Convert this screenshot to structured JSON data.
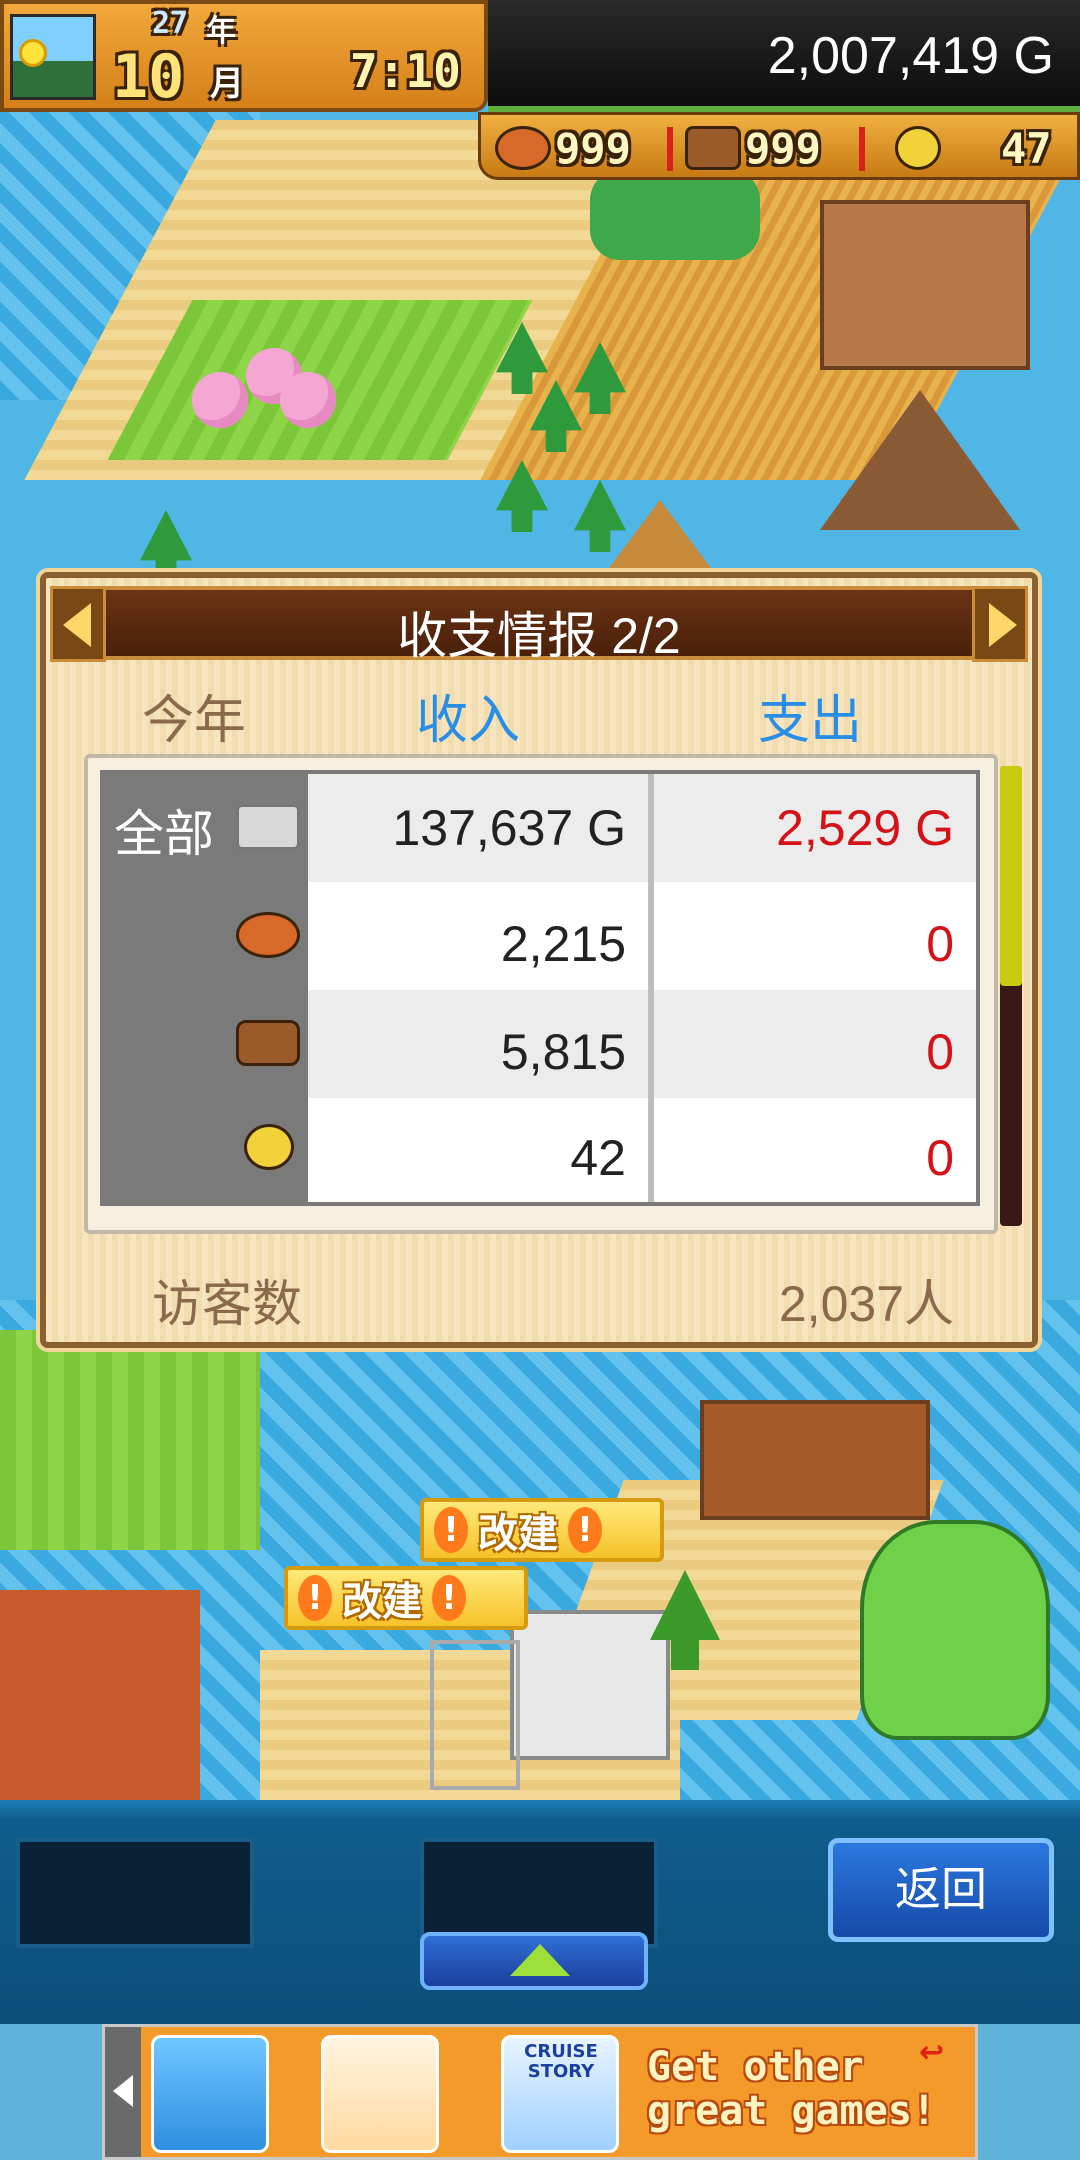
{
  "hud": {
    "year": "27",
    "year_unit": "年",
    "month": "10",
    "month_unit": "月",
    "clock": "7:10",
    "money": "2,007,419 G",
    "resources": [
      {
        "icon": "meat-icon",
        "value": "999"
      },
      {
        "icon": "wood-icon",
        "value": "999"
      },
      {
        "icon": "gold-coin-icon",
        "value": "47"
      }
    ]
  },
  "dialog": {
    "title": "收支情报 2/2",
    "headers": {
      "period": "今年",
      "income": "收入",
      "expense": "支出"
    },
    "rows": [
      {
        "label": "全部",
        "icon": "silver-ingot-icon",
        "income": "137,637 G",
        "expense": "2,529 G"
      },
      {
        "label": "",
        "icon": "meat-icon",
        "income": "2,215",
        "expense": "0"
      },
      {
        "label": "",
        "icon": "wood-icon",
        "income": "5,815",
        "expense": "0"
      },
      {
        "label": "",
        "icon": "gold-coin-icon",
        "income": "42",
        "expense": "0"
      }
    ],
    "visitors_label": "访客数",
    "visitors_value": "2,037人"
  },
  "map_tags": [
    {
      "text": "改建"
    },
    {
      "text": "改建"
    }
  ],
  "toolbar": {
    "back_label": "返回"
  },
  "ad": {
    "thumb3_label": "CRUISE STORY",
    "text_line1": "Get other",
    "text_line2": "great games!"
  },
  "colors": {
    "income_header": "#2b8ee6",
    "expense_value": "#d4121a",
    "dialog_bg": "#f6e5bf",
    "toolbar_bg": "#0b4f78"
  }
}
